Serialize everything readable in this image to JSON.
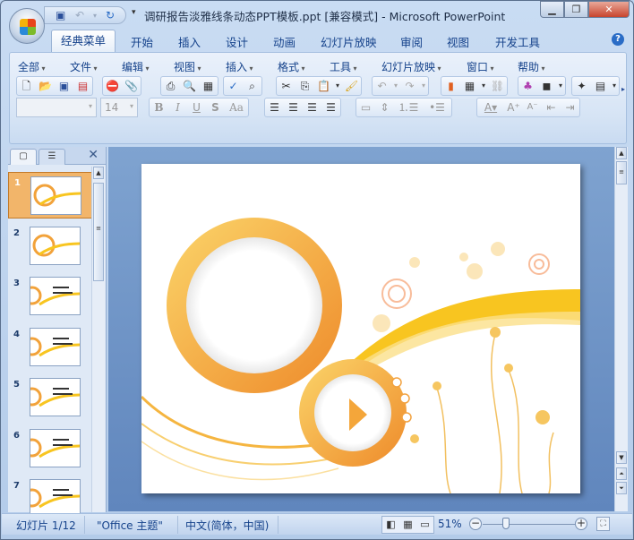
{
  "window": {
    "title": "调研报告淡雅线条动态PPT模板.ppt [兼容模式] - Microsoft PowerPoint",
    "controls": [
      "minimize",
      "restore",
      "close"
    ]
  },
  "qat": {
    "icons": [
      "save-icon",
      "undo-icon",
      "redo-icon",
      "customize-icon"
    ]
  },
  "tabs": [
    "经典菜单",
    "开始",
    "插入",
    "设计",
    "动画",
    "幻灯片放映",
    "审阅",
    "视图",
    "开发工具"
  ],
  "menus": [
    "全部",
    "文件",
    "编辑",
    "视图",
    "插入",
    "格式",
    "工具",
    "幻灯片放映",
    "窗口",
    "帮助"
  ],
  "toolbar": {
    "font_name": "",
    "font_size": "14",
    "bold": "B",
    "italic": "I",
    "underline": "U",
    "shadow": "S",
    "case": "Aa"
  },
  "pane": {
    "tabs": [
      "slides-tab",
      "outline-tab"
    ],
    "slides": [
      "1",
      "2",
      "3",
      "4",
      "5",
      "6",
      "7"
    ],
    "selected": "1"
  },
  "status": {
    "slide": "幻灯片 1/12",
    "theme": "\"Office 主题\"",
    "language": "中文(简体，中国)",
    "zoom": "51%",
    "zoom_value": 51
  },
  "colors": {
    "accent": "#f39a2b",
    "ribbon": "#d6e4f5"
  }
}
